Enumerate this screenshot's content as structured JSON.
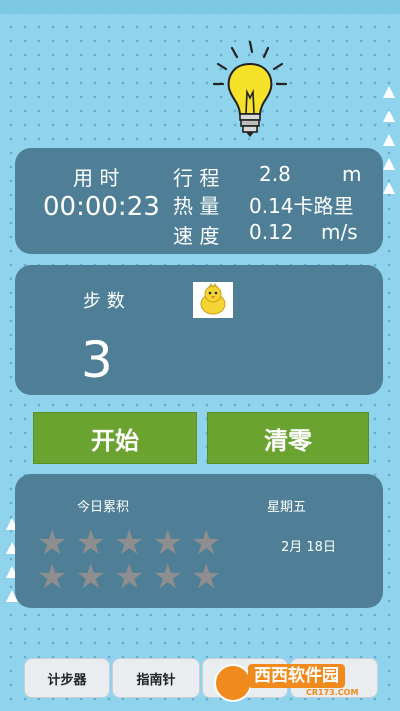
{
  "colors": {
    "background": "#8fd4ec",
    "panel": "#4e7f97",
    "button": "#6ba331",
    "star": "#8e8e8e"
  },
  "stats": {
    "time_label": "用 时",
    "time_value": "00:00:23",
    "distance_label": "行 程",
    "distance_value": "2.8",
    "distance_unit": "m",
    "calorie_label": "热 量",
    "calorie_value": "0.14卡路里",
    "speed_label": "速 度",
    "speed_value": "0.12",
    "speed_unit": "m/s"
  },
  "steps": {
    "label": "步 数",
    "value": "3",
    "icon": "chick-icon"
  },
  "buttons": {
    "start": "开始",
    "reset": "清零"
  },
  "calendar": {
    "today_label": "今日累积",
    "weekday": "星期五",
    "date": "2月 18日",
    "stars_row1": 5,
    "stars_row2": 5
  },
  "nav": {
    "tabs": [
      "计步器",
      "指南针",
      "水平",
      ""
    ]
  },
  "watermark": {
    "text": "西西软件园",
    "subtext": "CR173.COM"
  }
}
